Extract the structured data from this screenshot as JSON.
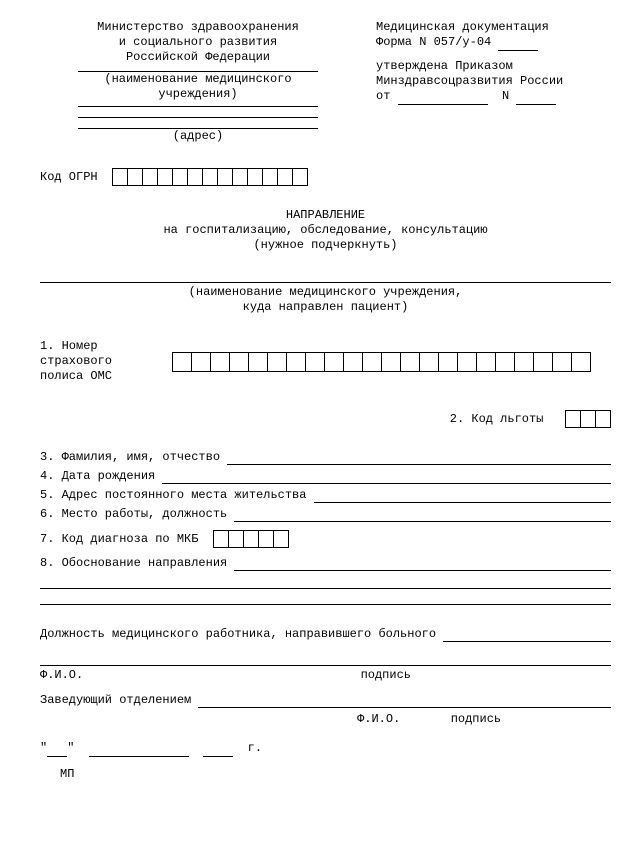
{
  "header_left": {
    "line1": "Министерство здравоохранения",
    "line2": "и социального развития",
    "line3": "Российской Федерации",
    "inst_label": "(наименование медицинского\nучреждения)",
    "addr_label": "(адрес)"
  },
  "header_right": {
    "line1": "Медицинская документация",
    "line2": "Форма N 057/у-04",
    "line3": "утверждена Приказом",
    "line4": "Минздравсоцразвития России",
    "ot": "от",
    "n": "N"
  },
  "ogrn_label": "Код ОГРН",
  "title": {
    "t1": "НАПРАВЛЕНИЕ",
    "t2": "на госпитализацию, обследование, консультацию",
    "t3": "(нужное подчеркнуть)",
    "dest1": "(наименование медицинского учреждения,",
    "dest2": "куда направлен пациент)"
  },
  "f": {
    "f1a": "1. Номер",
    "f1b": "страхового",
    "f1c": "полиса ОМС",
    "f2": "2. Код льготы",
    "f3": "3. Фамилия, имя, отчество",
    "f4": "4. Дата рождения",
    "f5": "5. Адрес постоянного места жительства",
    "f6": "6. Место работы, должность",
    "f7": "7. Код диагноза по МКБ",
    "f8": "8. Обоснование направления"
  },
  "sig": {
    "doctor": "Должность медицинского работника, направившего больного",
    "fio": "Ф.И.О.",
    "sign": "подпись",
    "head": "Заведующий отделением",
    "d_q": "\"",
    "g": "г.",
    "mp": "МП"
  }
}
